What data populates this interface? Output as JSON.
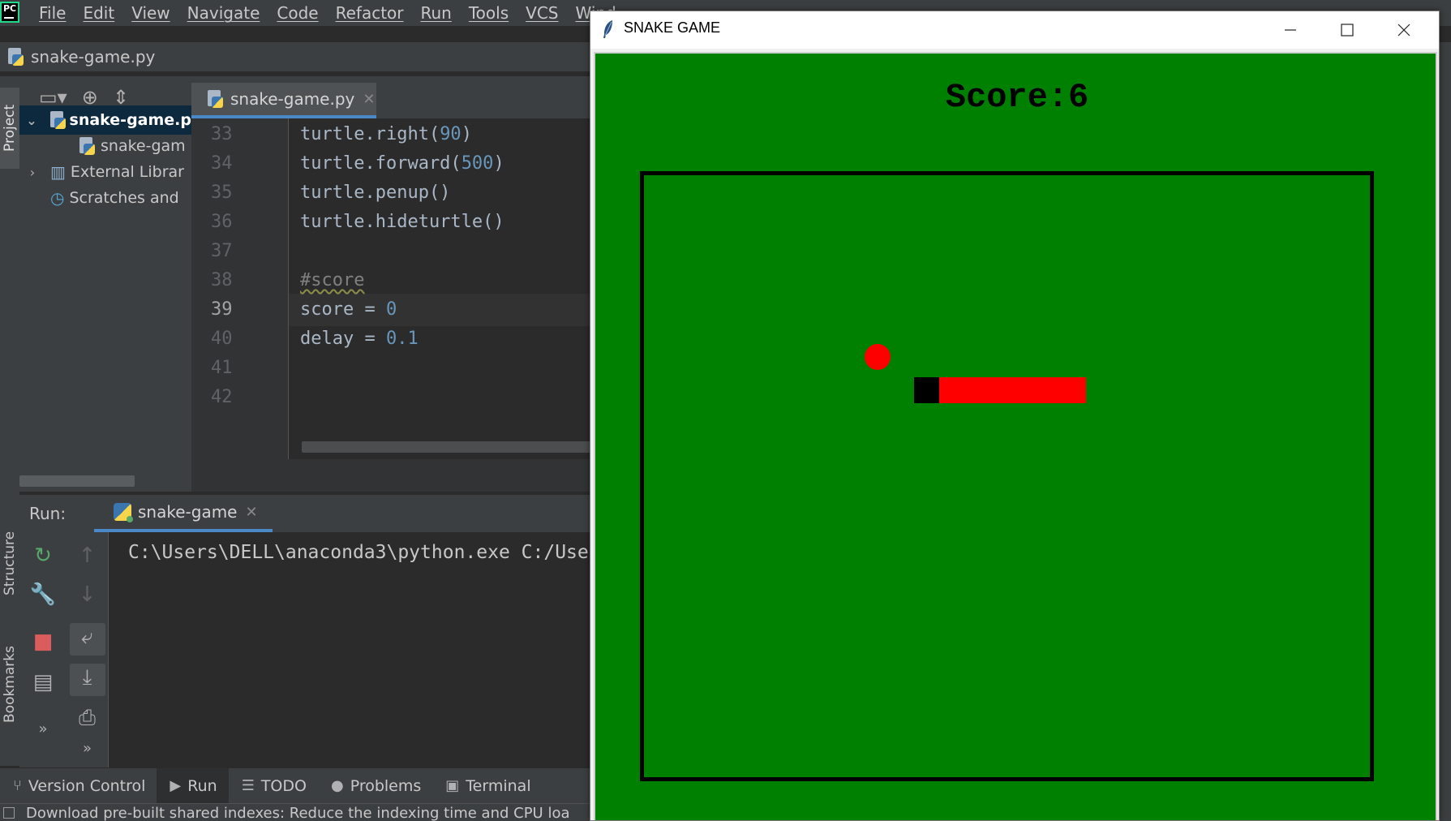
{
  "ide": {
    "menu": [
      "File",
      "Edit",
      "View",
      "Navigate",
      "Code",
      "Refactor",
      "Run",
      "Tools",
      "VCS",
      "Wind"
    ],
    "breadcrumb_file": "snake-game.py",
    "side_tabs": {
      "project": "Project",
      "structure": "Structure",
      "bookmarks": "Bookmarks"
    },
    "project_tree": [
      {
        "label": "snake-game.p",
        "selected": true
      },
      {
        "label": "snake-gam"
      },
      {
        "label": "External Librar"
      },
      {
        "label": "Scratches and"
      }
    ],
    "editor_tab": "snake-game.py",
    "line_numbers": [
      "33",
      "34",
      "35",
      "36",
      "37",
      "38",
      "39",
      "40",
      "41",
      "42"
    ],
    "code": {
      "l33_obj": "turtle.right(",
      "l33_num": "90",
      "l33_end": ")",
      "l34_obj": "turtle.forward(",
      "l34_num": "500",
      "l34_end": ")",
      "l35": "turtle.penup()",
      "l36": "turtle.hideturtle()",
      "l38": "#score",
      "l39_var": "score = ",
      "l39_num": "0",
      "l40_var": "delay = ",
      "l40_num": "0.1"
    },
    "run_label": "Run:",
    "run_tab": "snake-game",
    "console_line": "C:\\Users\\DELL\\anaconda3\\python.exe C:/Use",
    "bottom_tabs": [
      "Version Control",
      "Run",
      "TODO",
      "Problems",
      "Terminal"
    ],
    "status_text": "Download pre-built shared indexes: Reduce the indexing time and CPU loa"
  },
  "game": {
    "window_title": "SNAKE GAME",
    "score_text": "Score:6",
    "colors": {
      "background": "#008000",
      "food": "#ff0000",
      "head": "#000000",
      "body": "#ff0000"
    }
  }
}
